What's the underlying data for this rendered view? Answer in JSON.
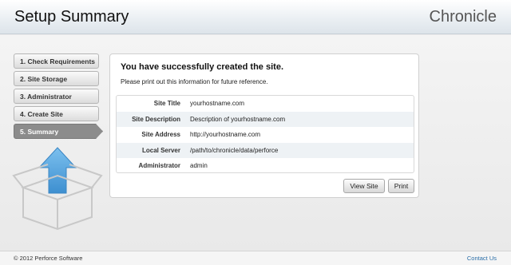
{
  "header": {
    "title": "Setup Summary",
    "brand": "Chronicle"
  },
  "steps": [
    {
      "label": "1. Check Requirements",
      "active": false
    },
    {
      "label": "2. Site Storage",
      "active": false
    },
    {
      "label": "3. Administrator",
      "active": false
    },
    {
      "label": "4. Create Site",
      "active": false
    },
    {
      "label": "5. Summary",
      "active": true
    }
  ],
  "panel": {
    "heading": "You have successfully created the site.",
    "subtext": "Please print out this information for future reference.",
    "rows": [
      {
        "label": "Site Title",
        "value": "yourhostname.com"
      },
      {
        "label": "Site Description",
        "value": "Description of yourhostname.com"
      },
      {
        "label": "Site Address",
        "value": "http://yourhostname.com"
      },
      {
        "label": "Local Server",
        "value": "/path/to/chronicle/data/perforce"
      },
      {
        "label": "Administrator",
        "value": "admin"
      }
    ],
    "buttons": {
      "view_site": "View Site",
      "print": "Print"
    }
  },
  "footer": {
    "copyright": "© 2012 Perforce Software",
    "contact": "Contact Us"
  },
  "colors": {
    "accent": "#2a6ea8",
    "arrow": "#5ba8e0",
    "active_step": "#8c8c8c"
  },
  "icons": {
    "illustration": "open-box-with-upload-arrow-icon"
  }
}
